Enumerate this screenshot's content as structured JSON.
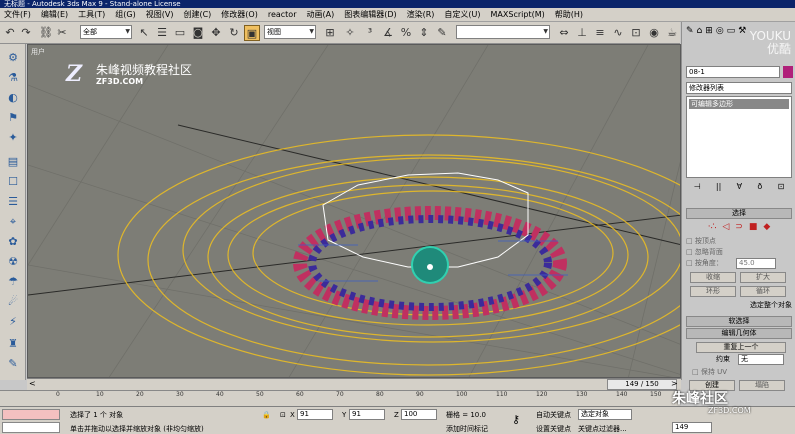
{
  "window": {
    "title": "无标题 - Autodesk 3ds Max 9 - Stand-alone License"
  },
  "menu": [
    "文件(F)",
    "编辑(E)",
    "工具(T)",
    "组(G)",
    "视图(V)",
    "创建(C)",
    "修改器(O)",
    "reactor",
    "动画(A)",
    "图表编辑器(D)",
    "渲染(R)",
    "自定义(U)",
    "MAXScript(M)",
    "帮助(H)"
  ],
  "toolbar": {
    "filter_select": "全部",
    "coord_select": "视图",
    "named_sel": "",
    "view_select": "视图"
  },
  "viewport": {
    "label": "用户",
    "logo_text": "朱峰视频教程社区",
    "logo_sub": "ZF3D.COM"
  },
  "command_panel": {
    "object_name": "08-1",
    "modifier_list": "修改器列表",
    "stack_item": "可编辑多边形",
    "selection_header": "选择",
    "by_vertex": "按顶点",
    "ignore_backfacing": "忽略背面",
    "by_angle": "按角度：",
    "angle_value": "45.0",
    "shrink": "收缩",
    "grow": "扩大",
    "ring": "环形",
    "loop": "循环",
    "selected_count": "选定整个对象",
    "soft_selection": "软选择",
    "edit_geometry": "编辑几何体",
    "repeat_last": "重复上一个",
    "constraint_label": "约束",
    "constraint_value": "无",
    "preserve_uv": "保持 UV",
    "create": "创建",
    "collapse": "塌陷"
  },
  "watermark_youku": [
    "YOUKU",
    "优酷"
  ],
  "timeline": {
    "frame": "149 / 150"
  },
  "ruler_ticks": [
    "0",
    "10",
    "20",
    "30",
    "40",
    "50",
    "60",
    "70",
    "80",
    "90",
    "100",
    "110",
    "120",
    "130",
    "140",
    "150"
  ],
  "status": {
    "selected": "选择了 1 个 对象",
    "prompt": "单击并拖动以选择并缩放对象 (非均匀缩放)",
    "x_label": "X",
    "x_value": "91",
    "y_label": "Y",
    "y_value": "91",
    "z_label": "Z",
    "z_value": "100",
    "grid": "栅格 = 10.0",
    "add_time_tag": "添加时间标记",
    "auto_key": "自动关键点",
    "selected_obj": "选定对象",
    "set_key": "设置关键点",
    "key_filters": "关键点过滤器...",
    "frame_field": "149"
  },
  "brand": {
    "name": "朱峰社区",
    "url": "ZF3D.COM"
  }
}
